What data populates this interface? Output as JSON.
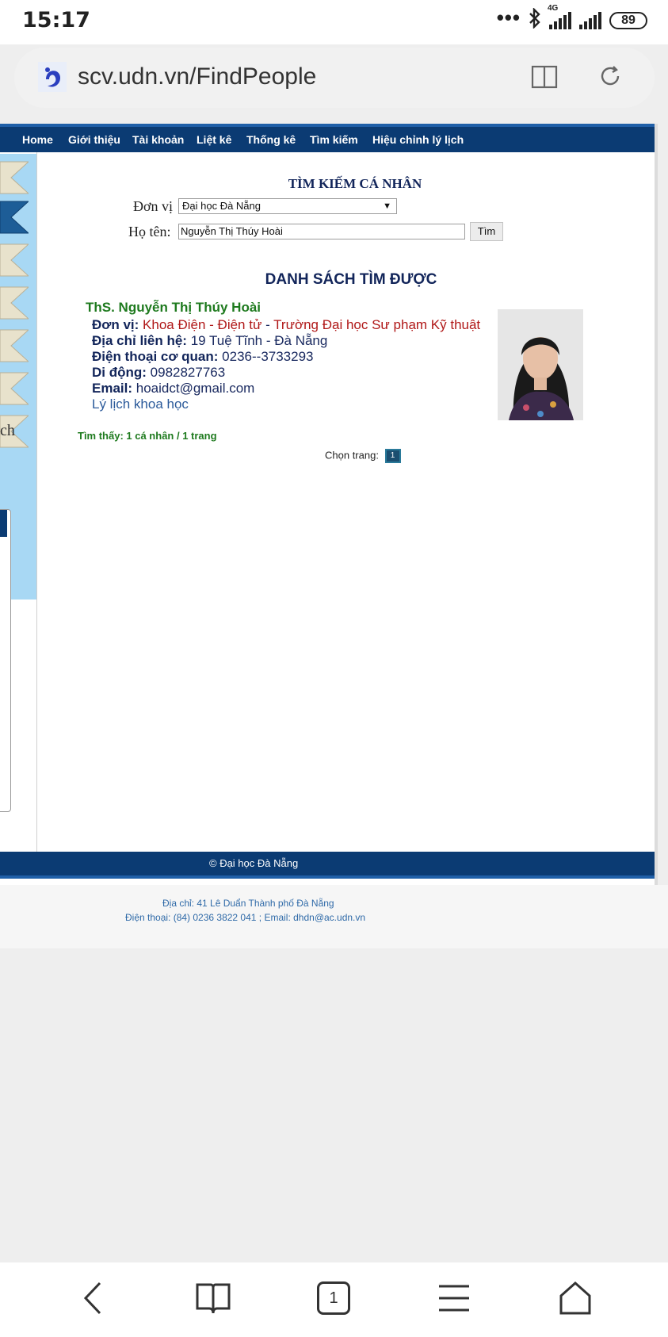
{
  "status_bar": {
    "time": "15:17",
    "signal_label": "4G",
    "battery": "89"
  },
  "browser": {
    "url": "scv.udn.vn/FindPeople",
    "tab_count": "1"
  },
  "nav": {
    "items": [
      "Home",
      "Giới thiệu",
      "Tài khoản",
      "Liệt kê",
      "Thống kê",
      "Tìm kiếm",
      "Hiệu chỉnh lý lịch"
    ]
  },
  "sidebar": {
    "partial_label": "ch"
  },
  "search": {
    "title": "TÌM KIẾM CÁ NHÂN",
    "unit_label": "Đơn vị",
    "unit_value": "Đại học Đà Nẵng",
    "name_label": "Họ tên:",
    "name_value": "Nguyễn Thị Thúy Hoài",
    "button": "Tìm"
  },
  "results": {
    "title": "DANH SÁCH TÌM ĐƯỢC",
    "person": {
      "name": "ThS. Nguyễn Thị Thúy Hoài",
      "unit_label": "Đơn vị:",
      "unit_faculty": "Khoa Điện - Điện tử",
      "unit_sep": " - ",
      "unit_school": "Trường Đại học Sư phạm Kỹ thuật",
      "address_label": "Địa chỉ liên hệ:",
      "address": "19 Tuệ Tĩnh - Đà Nẵng",
      "office_phone_label": "Điện thoại cơ quan:",
      "office_phone": "0236--3733293",
      "mobile_label": "Di động:",
      "mobile": "0982827763",
      "email_label": "Email:",
      "email": "hoaidct@gmail.com",
      "cv_link": "Lý lịch khoa học"
    },
    "found_text": "Tìm thấy: 1 cá nhân / 1 trang",
    "page_select_label": "Chọn trang:",
    "page_number": "1"
  },
  "footer": {
    "copyright": "© Đại học Đà Nẵng",
    "address": "Địa chỉ: 41 Lê Duẩn Thành phố Đà Nẵng",
    "contact": "Điện thoại: (84) 0236 3822 041 ; Email: dhdn@ac.udn.vn"
  },
  "colors": {
    "navbar": "#0b3b73",
    "sidebar": "#a8d8f4",
    "name_green": "#1e7a1e",
    "unit_red": "#b01818"
  }
}
